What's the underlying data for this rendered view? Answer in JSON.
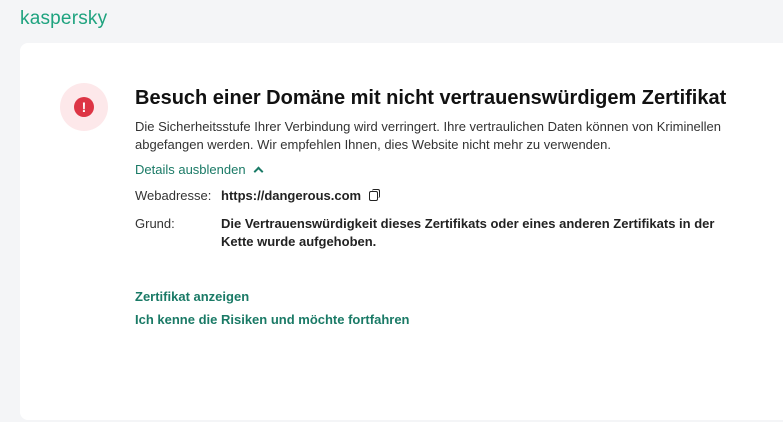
{
  "brand": {
    "logo": "kaspersky",
    "color": "#1fa37f"
  },
  "alert": {
    "icon": "exclamation-icon",
    "title": "Besuch einer Domäne mit nicht vertrauenswürdigem Zertifikat",
    "description": "Die Sicherheitsstufe Ihrer Verbindung wird verringert. Ihre vertraulichen Daten können von Kriminellen abgefangen werden. Wir empfehlen Ihnen, dies Website nicht mehr zu verwenden.",
    "details_toggle": "Details ausblenden",
    "details": {
      "url_label": "Webadresse:",
      "url": "https://dangerous.com",
      "reason_label": "Grund:",
      "reason": "Die Vertrauenswürdigkeit dieses Zertifikats oder eines anderen Zertifikats in der Kette wurde aufgehoben."
    },
    "actions": {
      "show_cert": "Zertifikat anzeigen",
      "proceed": "Ich kenne die Risiken und möchte fortfahren"
    }
  }
}
